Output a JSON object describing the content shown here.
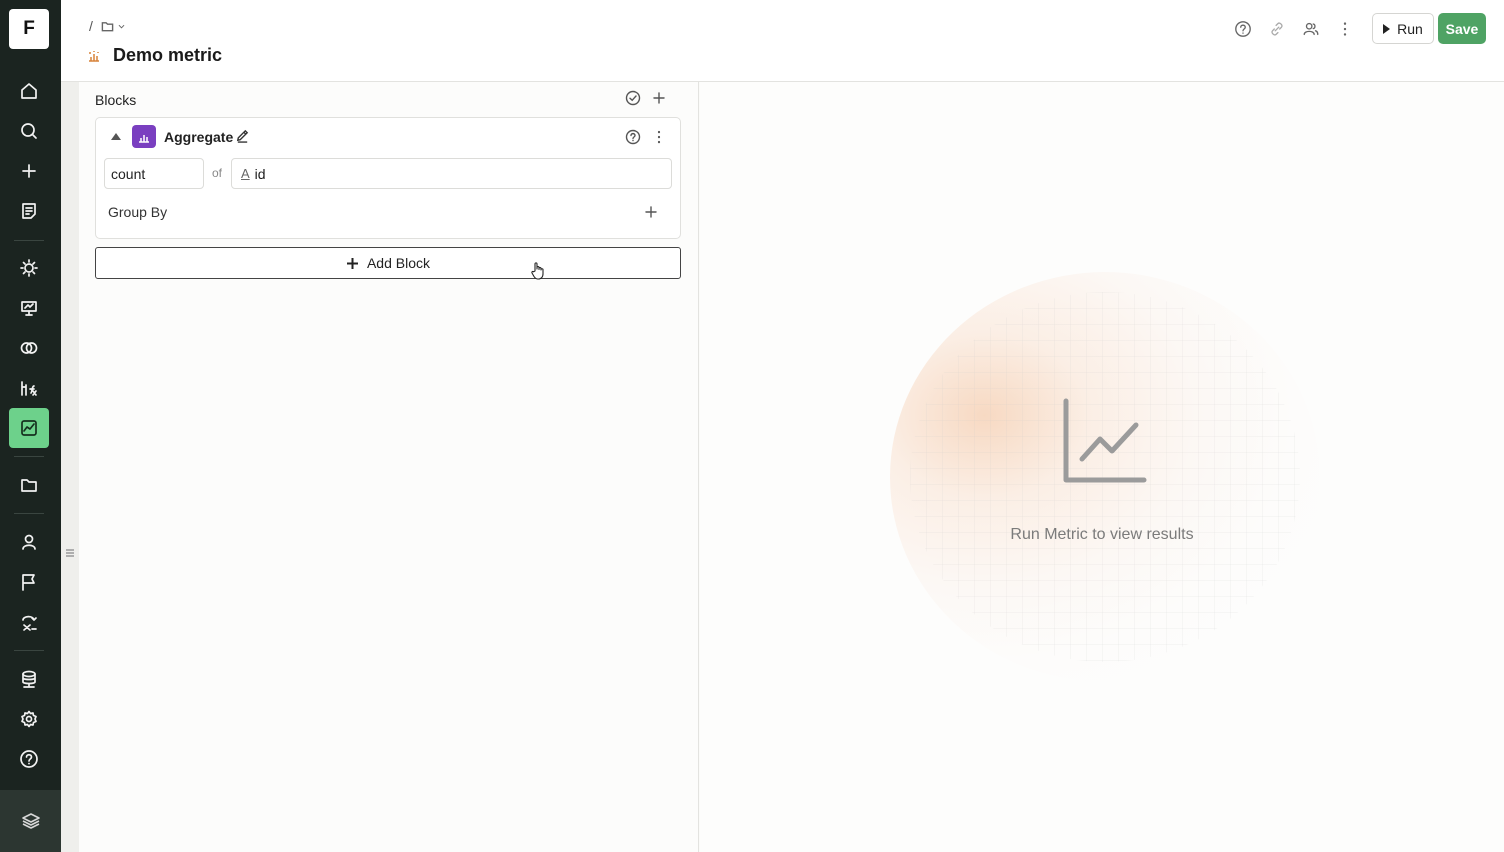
{
  "app": {
    "logo_letter": "F"
  },
  "sidebar": {
    "active_color": "#6dd18b",
    "items": [
      {
        "icon": "home-icon"
      },
      {
        "icon": "search-icon"
      },
      {
        "icon": "plus-icon"
      },
      {
        "icon": "notebook-icon"
      },
      {
        "icon": "lightbulb-icon"
      },
      {
        "icon": "presentation-icon"
      },
      {
        "icon": "venn-icon"
      },
      {
        "icon": "formula-icon"
      },
      {
        "icon": "metric-chart-icon",
        "active": true
      },
      {
        "icon": "folder-icon"
      },
      {
        "icon": "user-icon"
      },
      {
        "icon": "flag-icon"
      },
      {
        "icon": "transform-icon"
      },
      {
        "icon": "database-icon"
      },
      {
        "icon": "gear-icon"
      },
      {
        "icon": "help-icon"
      }
    ]
  },
  "header": {
    "breadcrumb_sep": "/",
    "title": "Demo metric",
    "run_label": "Run",
    "save_label": "Save",
    "save_color": "#4fa364"
  },
  "blocks_panel": {
    "heading": "Blocks",
    "block": {
      "title": "Aggregate",
      "badge_color": "#7a3fc0",
      "function_value": "count",
      "of_label": "of",
      "column_type": "A",
      "column_value": "id",
      "group_by_label": "Group By"
    },
    "add_block_label": "Add Block"
  },
  "results": {
    "empty_message": "Run Metric to view results"
  }
}
